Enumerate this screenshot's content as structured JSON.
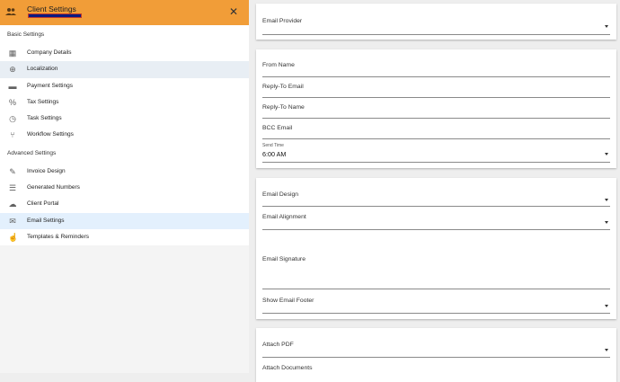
{
  "sidebar": {
    "title": "Client Settings",
    "basic_label": "Basic Settings",
    "basic_items": [
      {
        "label": "Company Details",
        "icon": "company-icon"
      },
      {
        "label": "Localization",
        "icon": "globe-icon"
      },
      {
        "label": "Payment Settings",
        "icon": "credit-card-icon"
      },
      {
        "label": "Tax Settings",
        "icon": "percent-icon"
      },
      {
        "label": "Task Settings",
        "icon": "clock-icon"
      },
      {
        "label": "Workflow Settings",
        "icon": "workflow-icon"
      }
    ],
    "advanced_label": "Advanced Settings",
    "advanced_items": [
      {
        "label": "Invoice Design",
        "icon": "brush-icon"
      },
      {
        "label": "Generated Numbers",
        "icon": "list-icon"
      },
      {
        "label": "Client Portal",
        "icon": "cloud-icon"
      },
      {
        "label": "Email Settings",
        "icon": "email-icon"
      },
      {
        "label": "Templates & Reminders",
        "icon": "hand-pointer-icon"
      }
    ],
    "colors": {
      "header": "#f19d38",
      "active": "#e8eef4",
      "current": "#e3f0fd"
    }
  },
  "main": {
    "email_provider": "Email Provider",
    "from_name": "From Name",
    "reply_to_email": "Reply-To Email",
    "reply_to_name": "Reply-To Name",
    "bcc_email": "BCC Email",
    "send_time_label": "Send Time",
    "send_time_value": "6:00 AM",
    "email_design": "Email Design",
    "email_alignment": "Email Alignment",
    "email_signature": "Email Signature",
    "show_email_footer": "Show Email Footer",
    "attach_pdf": "Attach PDF",
    "attach_documents": "Attach Documents"
  }
}
